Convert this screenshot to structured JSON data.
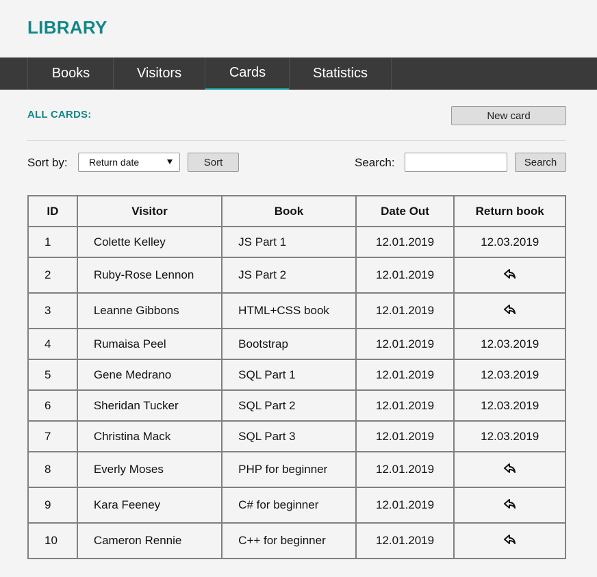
{
  "app": {
    "logo": "LIBRARY"
  },
  "nav": {
    "tabs": [
      {
        "label": "Books"
      },
      {
        "label": "Visitors"
      },
      {
        "label": "Cards",
        "active": true
      },
      {
        "label": "Statistics"
      }
    ]
  },
  "section": {
    "title": "ALL CARDS:",
    "new_card_label": "New card"
  },
  "toolbar": {
    "sort_label": "Sort by:",
    "sort_selected": "Return date",
    "sort_button": "Sort",
    "search_label": "Search:",
    "search_value": "",
    "search_placeholder": "",
    "search_button": "Search"
  },
  "table": {
    "columns": [
      "ID",
      "Visitor",
      "Book",
      "Date Out",
      "Return book"
    ],
    "rows": [
      {
        "id": "1",
        "visitor": "Colette Kelley",
        "book": "JS Part 1",
        "date_out": "12.01.2019",
        "return": "12.03.2019"
      },
      {
        "id": "2",
        "visitor": "Ruby-Rose Lennon",
        "book": "JS Part 2",
        "date_out": "12.01.2019",
        "return": null,
        "return_icon": "return-arrow-icon"
      },
      {
        "id": "3",
        "visitor": "Leanne Gibbons",
        "book": "HTML+CSS book",
        "date_out": "12.01.2019",
        "return": null,
        "return_icon": "return-arrow-icon"
      },
      {
        "id": "4",
        "visitor": "Rumaisa Peel",
        "book": "Bootstrap",
        "date_out": "12.01.2019",
        "return": "12.03.2019"
      },
      {
        "id": "5",
        "visitor": "Gene Medrano",
        "book": "SQL Part 1",
        "date_out": "12.01.2019",
        "return": "12.03.2019"
      },
      {
        "id": "6",
        "visitor": "Sheridan Tucker",
        "book": "SQL Part 2",
        "date_out": "12.01.2019",
        "return": "12.03.2019"
      },
      {
        "id": "7",
        "visitor": "Christina Mack",
        "book": "SQL Part 3",
        "date_out": "12.01.2019",
        "return": "12.03.2019"
      },
      {
        "id": "8",
        "visitor": "Everly Moses",
        "book": "PHP for beginner",
        "date_out": "12.01.2019",
        "return": null,
        "return_icon": "return-arrow-icon"
      },
      {
        "id": "9",
        "visitor": "Kara Feeney",
        "book": "C# for beginner",
        "date_out": "12.01.2019",
        "return": null,
        "return_icon": "return-arrow-icon"
      },
      {
        "id": "10",
        "visitor": "Cameron Rennie",
        "book": "C++ for beginner",
        "date_out": "12.01.2019",
        "return": null,
        "return_icon": "return-arrow-icon"
      }
    ]
  },
  "colors": {
    "accent": "#12878a",
    "nav_bg": "#3a3a3a",
    "active_underline": "#17a2a5",
    "page_bg": "#f4f4f4"
  }
}
